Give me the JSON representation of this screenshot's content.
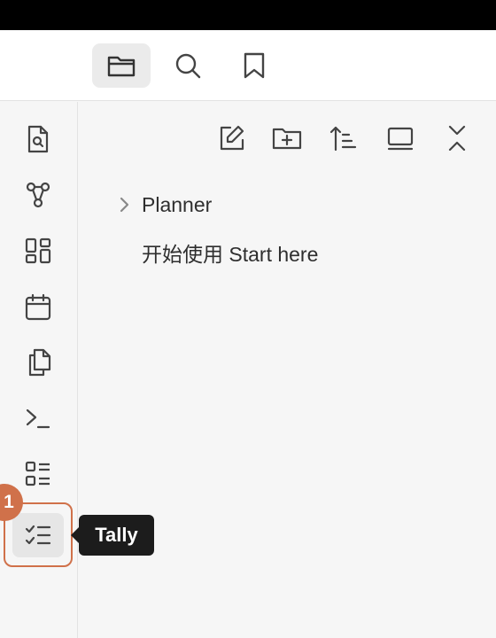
{
  "tabs": [
    {
      "name": "folder-icon",
      "active": true
    },
    {
      "name": "search-icon",
      "active": false
    },
    {
      "name": "bookmark-icon",
      "active": false
    }
  ],
  "ribbon": [
    "search-document-icon",
    "graph-icon",
    "dashboard-icon",
    "calendar-icon",
    "copy-files-icon",
    "terminal-icon",
    "list-checklist-icon",
    "tally-checklist-icon"
  ],
  "nav_actions": [
    "new-note-icon",
    "new-folder-icon",
    "sort-icon",
    "collapse-view-icon",
    "collapse-all-icon"
  ],
  "tree": {
    "items": [
      {
        "label": "Planner",
        "type": "folder"
      },
      {
        "label": "开始使用 Start here",
        "type": "file"
      }
    ]
  },
  "tooltip": {
    "text": "Tally"
  },
  "badge": {
    "text": "1"
  },
  "colors": {
    "accent": "#d0714a",
    "tooltip_bg": "#1c1c1c",
    "pane_bg": "#f6f6f6"
  }
}
